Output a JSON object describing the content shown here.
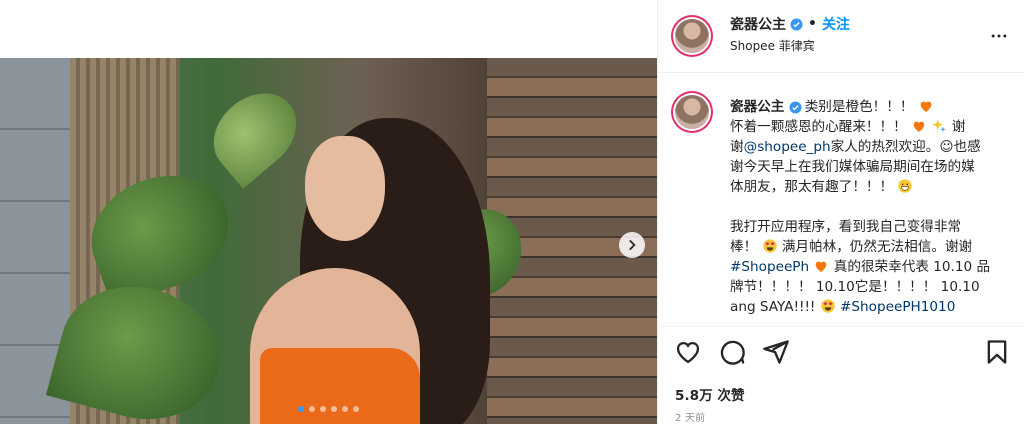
{
  "post": {
    "user": "瓷器公主",
    "follow_label": "关注",
    "separator": "•",
    "location": "Shopee 菲律宾",
    "caption": {
      "line1": "类别是橙色！！！",
      "line2": "怀着一颗感恩的心醒来！！！",
      "line2b": "谢",
      "line3a": "谢",
      "line3_link": "@shopee_ph",
      "line3b": "家人的热烈欢迎。☺也感",
      "line4": "谢今天早上在我们媒体骗局期间在场的媒",
      "line5": "体朋友，那太有趣了！！！",
      "line6": "我打开应用程序，看到我自己变得非常",
      "line7a": "棒！",
      "line7b": "满月帕林，仍然无法相信。谢谢",
      "line8_link": "#ShopeePh",
      "line8b": "真的很荣幸代表 10.10 品",
      "line9": "牌节！！！！ 10.10它是！！！！ 10.10",
      "line10a": "ang SAYA!!!!",
      "line10_link": "#ShopeePH1010"
    },
    "likes": "5.8万 次赞",
    "time": "2 天前"
  },
  "carousel": {
    "slides": 6,
    "active_index": 0
  },
  "icons": {
    "verified": "verified-badge-icon",
    "heart": "orange-heart-emoji",
    "sparkles": "sparkles-emoji",
    "heart_eyes": "heart-eyes-emoji",
    "grin": "grinning-emoji",
    "like": "heart-outline-icon",
    "comment": "comment-icon",
    "share": "paper-plane-icon",
    "save": "bookmark-icon",
    "more": "more-horizontal-icon",
    "next": "chevron-right-icon"
  },
  "colors": {
    "accent": "#0095f6",
    "link": "#00376b",
    "ring": "#e1306c"
  }
}
